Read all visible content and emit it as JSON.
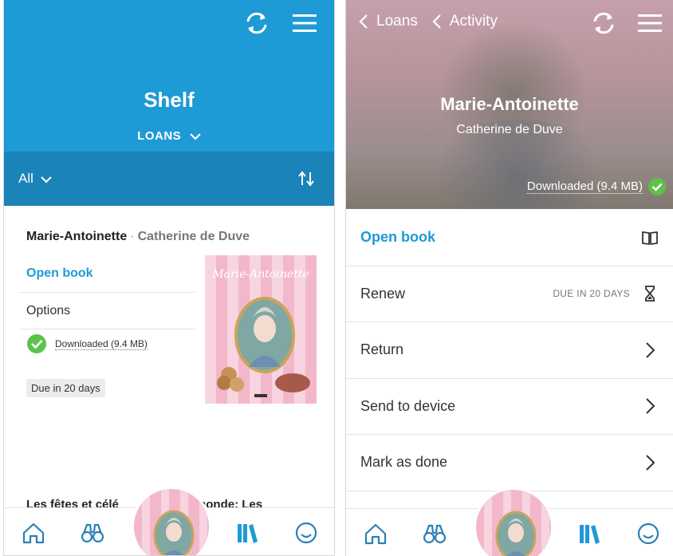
{
  "left": {
    "header": {
      "title": "Shelf",
      "subtitle": "LOANS",
      "icons": [
        "sync-icon",
        "menu-icon",
        "chevron-down-icon"
      ]
    },
    "filter": {
      "label": "All",
      "icons": [
        "chevron-down-icon",
        "sort-icon"
      ]
    },
    "book": {
      "title": "Marie-Antoinette",
      "separator": "·",
      "author": "Catherine de Duve",
      "open_label": "Open book",
      "options_label": "Options",
      "downloaded_label": "Downloaded (9.4 MB)",
      "due_label": "Due in 20 days"
    },
    "next_book_title": "Les fêtes et célé",
    "next_book_title_tail": "monde: Les"
  },
  "right": {
    "nav": {
      "back1": "Loans",
      "back2": "Activity"
    },
    "header": {
      "title": "Marie-Antoinette",
      "author": "Catherine de Duve",
      "downloaded_label": "Downloaded (9.4 MB)"
    },
    "menu": [
      {
        "label": "Open book",
        "icon": "book-open-icon"
      },
      {
        "label": "Renew",
        "meta": "DUE IN 20 DAYS",
        "icon": "hourglass-icon"
      },
      {
        "label": "Return",
        "icon": "chevron-right-icon"
      },
      {
        "label": "Send to device",
        "icon": "chevron-right-icon"
      },
      {
        "label": "Mark as done",
        "icon": "chevron-right-icon"
      }
    ]
  },
  "tabbar": {
    "icons": [
      "home-icon",
      "binoculars-icon",
      "avatar",
      "shelf-icon",
      "smiley-icon"
    ]
  },
  "colors": {
    "accent": "#1e9ad6",
    "header_dark": "#1a83b8",
    "check_green": "#5cc24a",
    "cover_pink": "#f2b8c9"
  }
}
